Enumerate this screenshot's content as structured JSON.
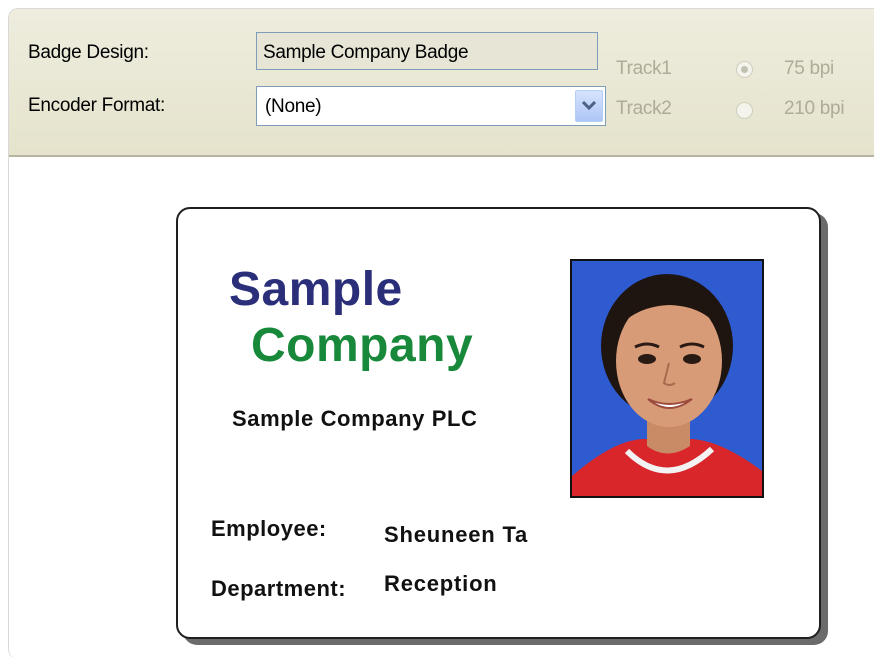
{
  "form": {
    "badge_design_label": "Badge Design:",
    "badge_design_value": "Sample Company Badge",
    "encoder_format_label": "Encoder Format:",
    "encoder_format_selected": "(None)",
    "track1_label": "Track1",
    "track2_label": "Track2",
    "bpi_75_label": "75 bpi",
    "bpi_210_label": "210 bpi",
    "bpi_75_selected": true,
    "bpi_210_selected": false
  },
  "badge": {
    "logo_line1": "Sample",
    "logo_line2": "Company",
    "company_name": "Sample Company PLC",
    "employee_label": "Employee:",
    "employee_value": "Sheuneen  Ta",
    "department_label": "Department:",
    "department_value": "Reception",
    "photo_icon": "employee-photo"
  },
  "colors": {
    "logo_blue": "#2b2f7a",
    "logo_green": "#18893a",
    "photo_background": "#2f5bd0",
    "toolbar_background": "#eeedde",
    "disabled_text": "#aeac98"
  }
}
